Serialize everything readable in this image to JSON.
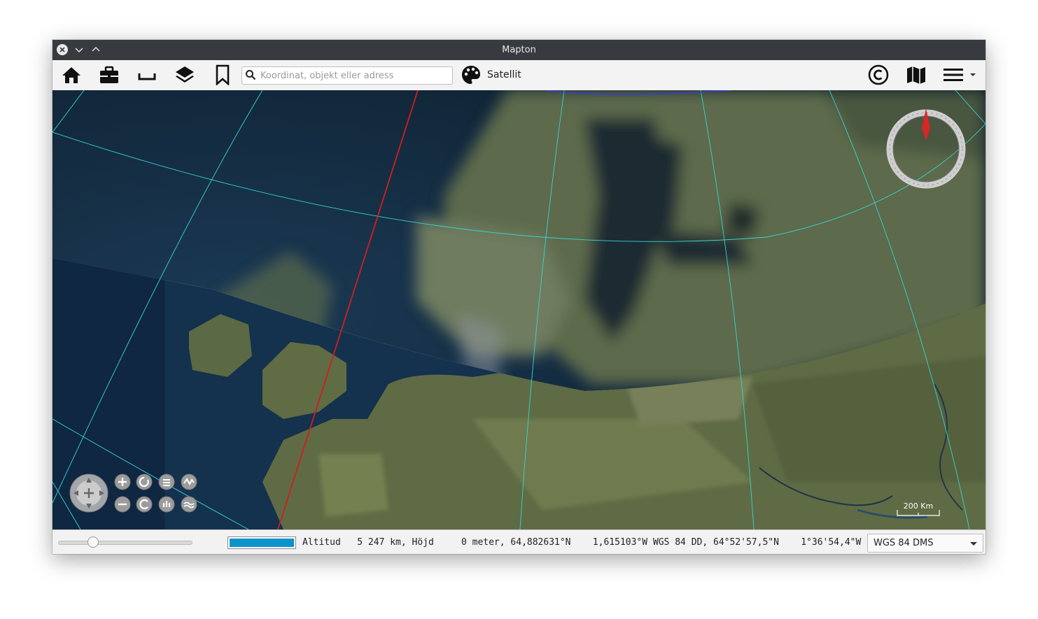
{
  "window": {
    "title": "Mapton"
  },
  "toolbar": {
    "icons": [
      "home-icon",
      "briefcase-icon",
      "ruler-icon",
      "layers-icon",
      "bookmark-icon"
    ],
    "search_placeholder": "Koordinat, objekt eller adress",
    "map_style_label": "Satellit",
    "right_icons": [
      "copyright-icon",
      "map-icon",
      "menu-icon"
    ]
  },
  "map": {
    "scale_label": "200 Km",
    "controls": [
      "pan-control",
      "zoom-in",
      "zoom-out",
      "rotate",
      "reset-heading",
      "tilt-up",
      "tilt-down",
      "exaggerate-up",
      "exaggerate-down"
    ]
  },
  "status": {
    "progress_fraction": 1.0,
    "zoom_fraction": 0.25,
    "coordinates_text": "Altitud   5 247 km, Höjd     0 meter, 64,882631°N    1,615103°W WGS 84 DD, 64°52'57,5\"N    1°36'54,4\"W",
    "crs_value": "WGS 84 DMS"
  },
  "colors": {
    "titlebar": "#373a3e",
    "progress": "#0c93cc",
    "graticule": "#33d6d6",
    "dateline": "#d21e1e"
  }
}
